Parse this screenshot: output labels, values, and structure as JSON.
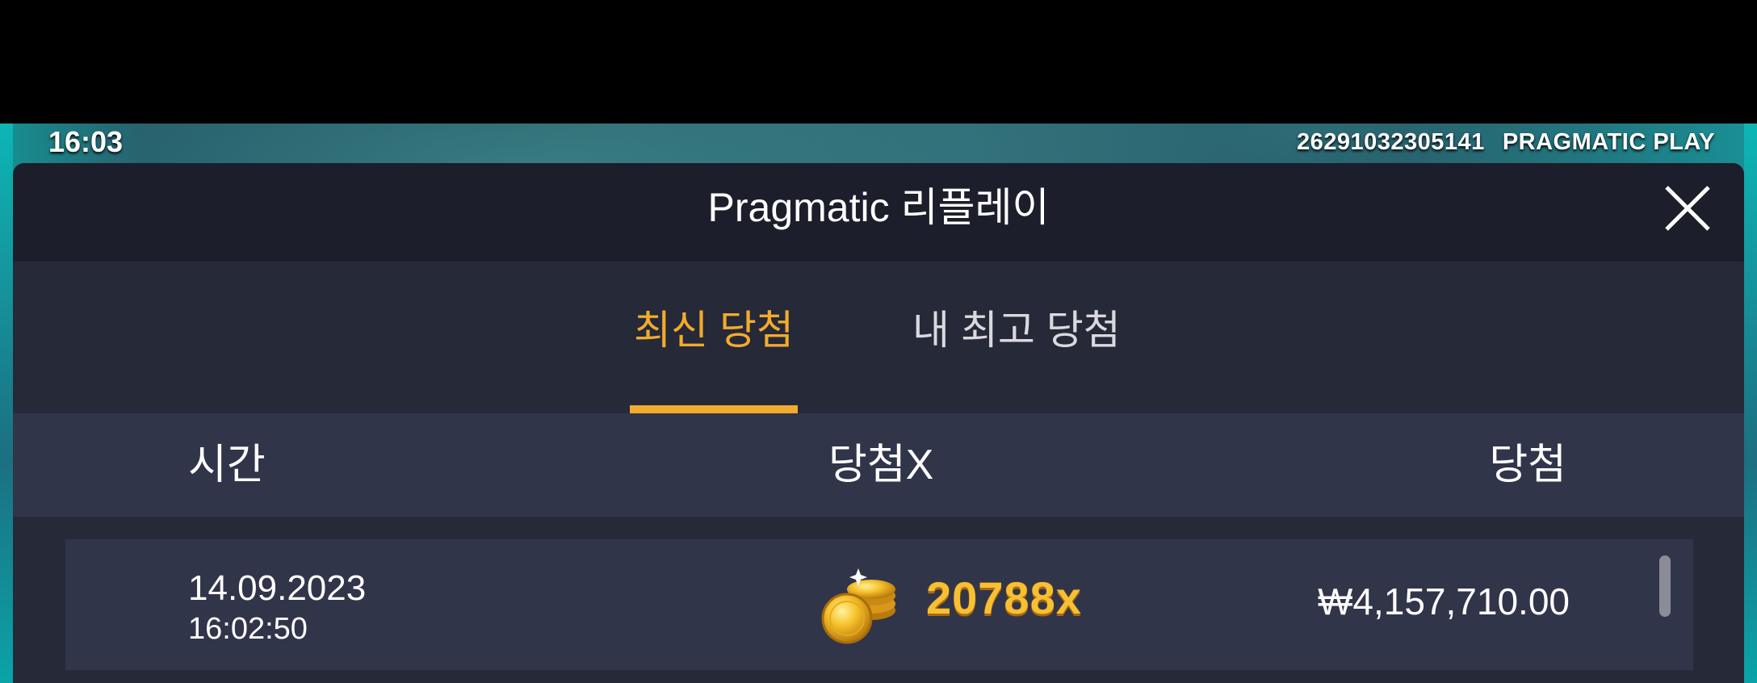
{
  "status_bar": {
    "clock": "16:03",
    "session_id": "26291032305141",
    "brand": "PRAGMATIC PLAY"
  },
  "modal": {
    "title": "Pragmatic 리플레이",
    "close_icon": "close-icon",
    "tabs": [
      {
        "label": "최신 당첨",
        "active": true
      },
      {
        "label": "내 최고 당첨",
        "active": false
      }
    ],
    "columns": {
      "time": "시간",
      "multiplier": "당첨X",
      "win": "당첨"
    },
    "rows": [
      {
        "date": "14.09.2023",
        "time": "16:02:50",
        "icon": "gold-coins-icon",
        "multiplier": "20788x",
        "win": "₩4,157,710.00"
      }
    ]
  },
  "colors": {
    "accent": "#f2ab2d",
    "modal_bg": "#1c1f2b",
    "tabs_bg": "#252938",
    "header_row_bg": "#31354a"
  }
}
